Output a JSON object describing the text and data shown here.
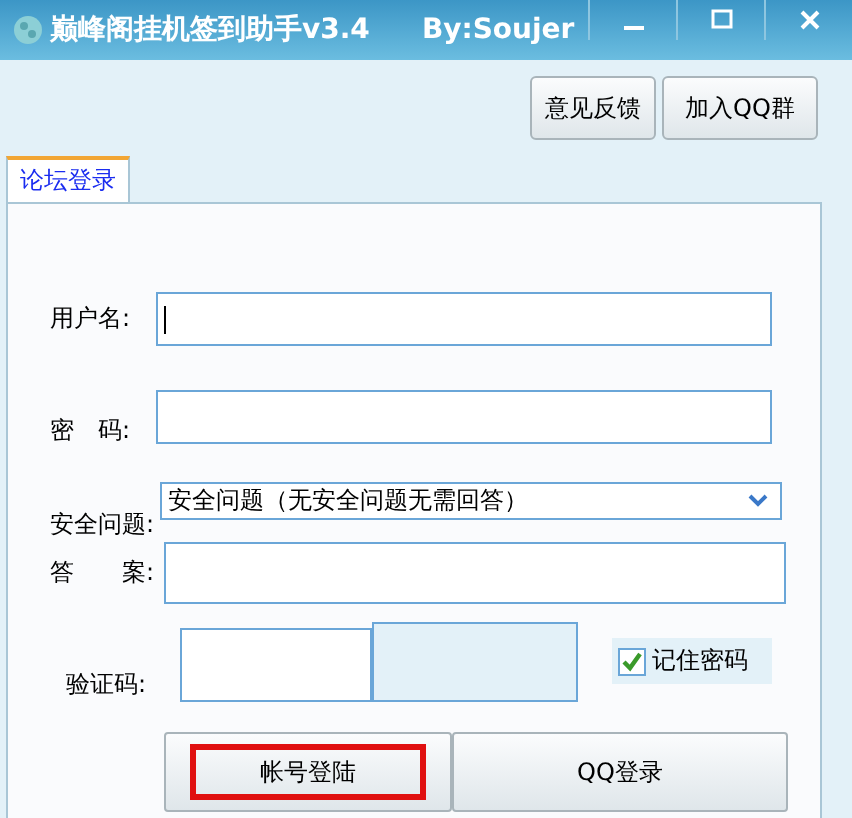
{
  "window": {
    "title": "巅峰阁挂机签到助手v3.4",
    "author": "By:Soujer"
  },
  "top_buttons": [
    "意见反馈",
    "加入QQ群"
  ],
  "tabs": [
    {
      "label": "论坛登录",
      "selected": true
    }
  ],
  "form": {
    "username_label": "用户名:",
    "password_label": "密　码:",
    "question_label": "安全问题:",
    "question_value": "安全问题（无安全问题无需回答）",
    "answer_label": "答　　案:",
    "captcha_label": "验证码:",
    "remember": {
      "label": "记住密码",
      "checked": true
    }
  },
  "actions": [
    {
      "label": "帐号登陆",
      "highlighted": true
    },
    {
      "label": "QQ登录",
      "highlighted": false
    }
  ]
}
